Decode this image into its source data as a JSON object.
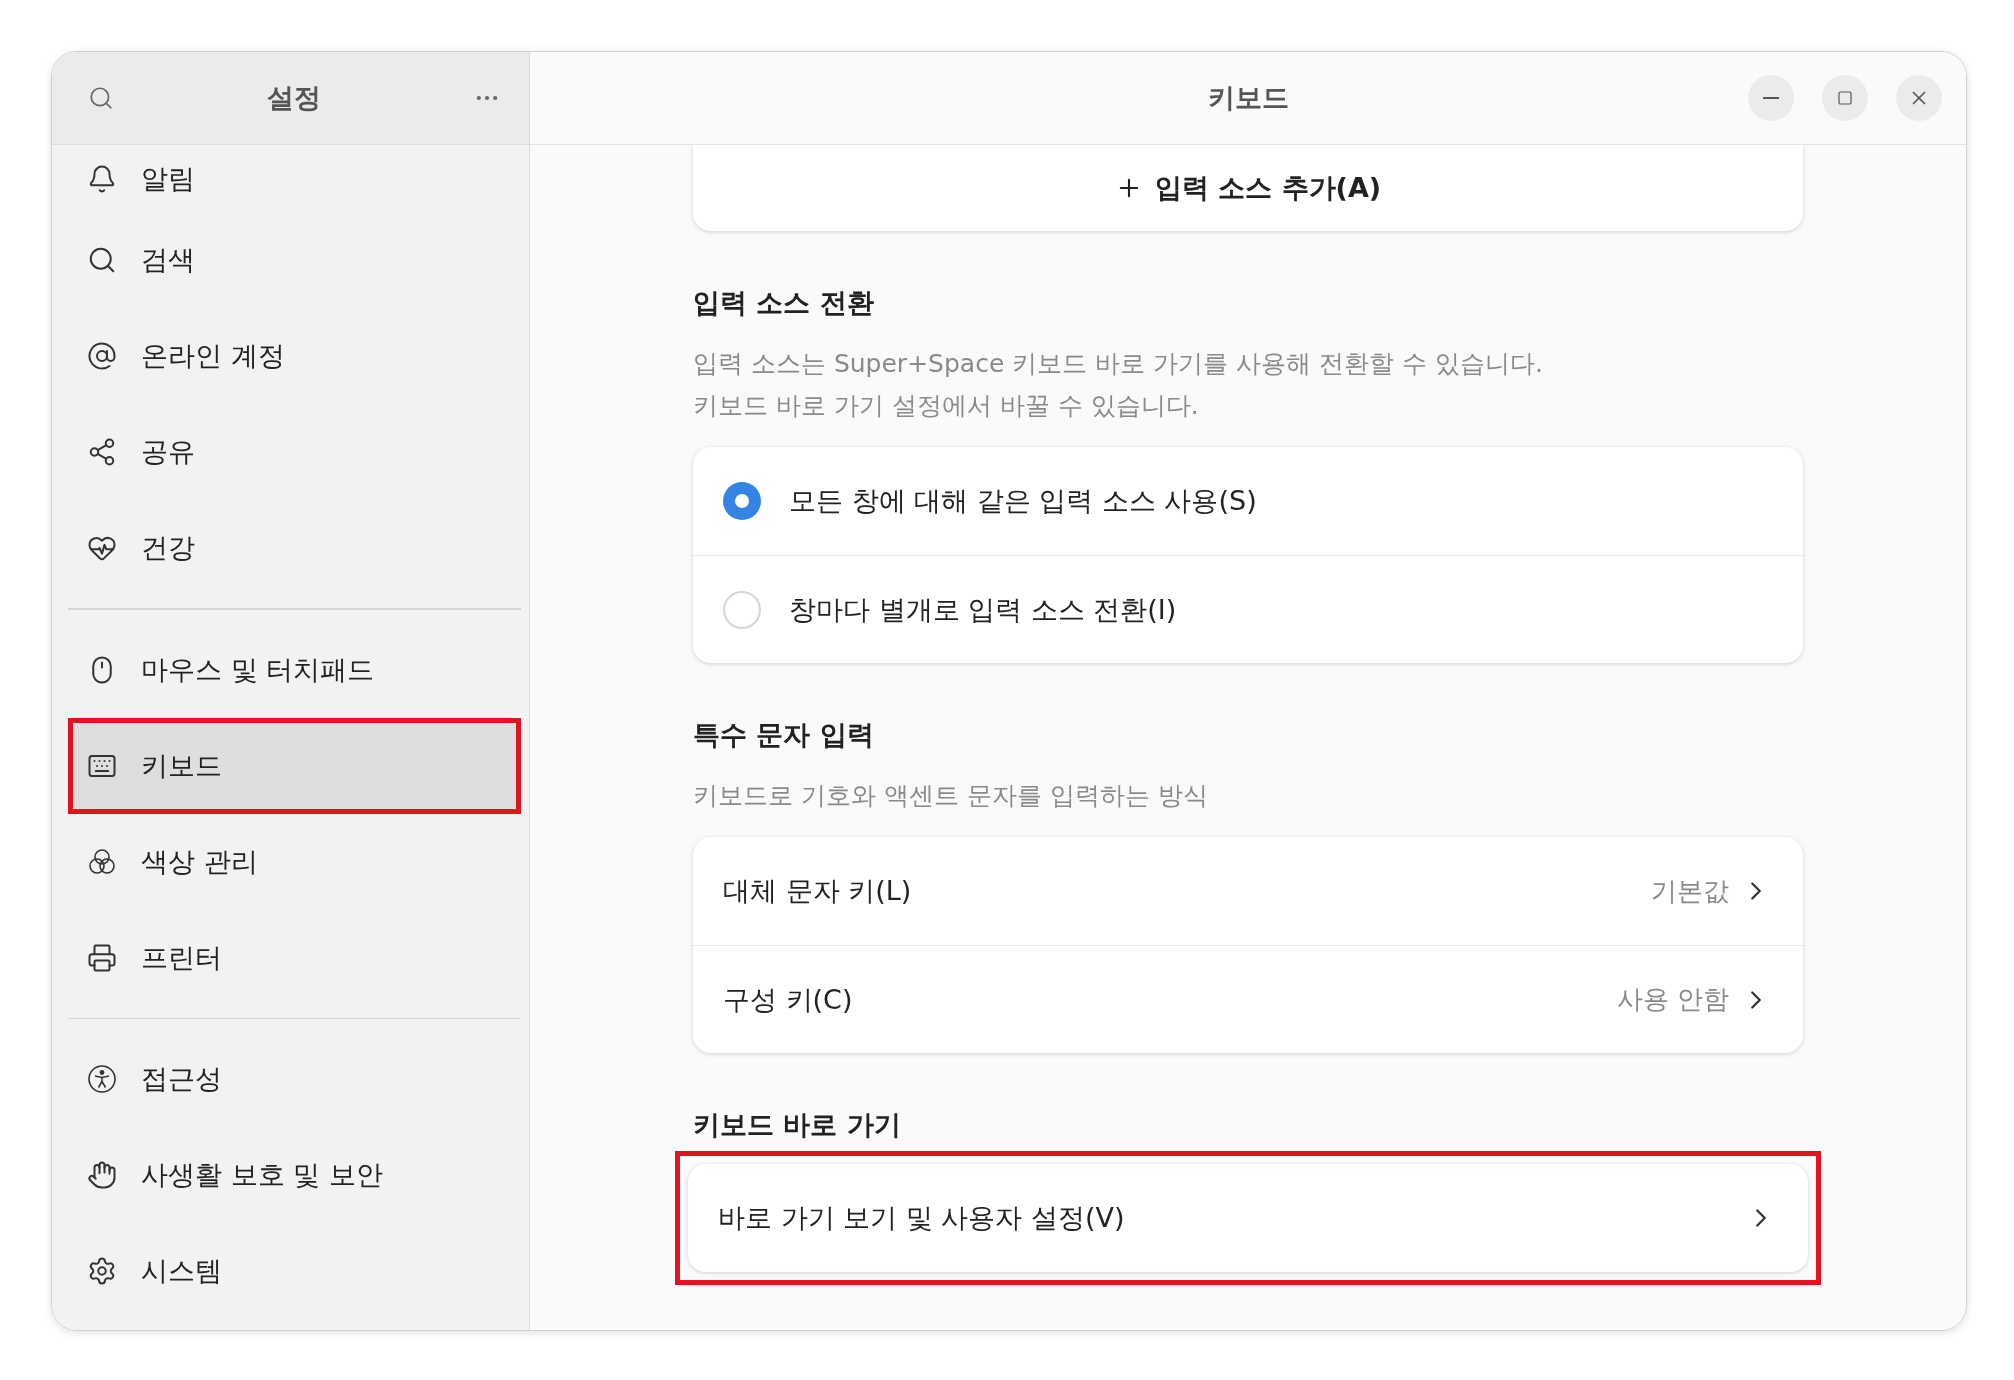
{
  "sidebar": {
    "title": "설정",
    "groups": [
      {
        "items": [
          {
            "label": "알림",
            "selected": false,
            "highlighted": false
          },
          {
            "label": "검색",
            "selected": false,
            "highlighted": false
          },
          {
            "label": "온라인 계정",
            "selected": false,
            "highlighted": false
          },
          {
            "label": "공유",
            "selected": false,
            "highlighted": false
          },
          {
            "label": "건강",
            "selected": false,
            "highlighted": false
          }
        ]
      },
      {
        "items": [
          {
            "label": "마우스 및 터치패드",
            "selected": false,
            "highlighted": false
          },
          {
            "label": "키보드",
            "selected": true,
            "highlighted": true
          },
          {
            "label": "색상 관리",
            "selected": false,
            "highlighted": false
          },
          {
            "label": "프린터",
            "selected": false,
            "highlighted": false
          }
        ]
      },
      {
        "items": [
          {
            "label": "접근성",
            "selected": false,
            "highlighted": false
          },
          {
            "label": "사생활 보호 및 보안",
            "selected": false,
            "highlighted": false
          },
          {
            "label": "시스템",
            "selected": false,
            "highlighted": false
          }
        ]
      }
    ]
  },
  "window": {
    "title": "키보드"
  },
  "add_source": {
    "label": "입력 소스 추가(A)"
  },
  "sections": [
    {
      "kind": "radio",
      "heading": "입력 소스 전환",
      "description": [
        "입력 소스는 Super+Space 키보드 바로 가기를 사용해 전환할 수 있습니다.",
        "키보드 바로 가기 설정에서 바꿀 수 있습니다."
      ],
      "highlighted": false,
      "options": [
        {
          "label": "모든 창에 대해 같은 입력 소스 사용(S)",
          "selected": true
        },
        {
          "label": "창마다 별개로 입력 소스 전환(I)",
          "selected": false
        }
      ]
    },
    {
      "kind": "rows",
      "heading": "특수 문자 입력",
      "description": [
        "키보드로 기호와 액센트 문자를 입력하는 방식"
      ],
      "highlighted": false,
      "rows": [
        {
          "label": "대체 문자 키(L)",
          "value": "기본값"
        },
        {
          "label": "구성 키(C)",
          "value": "사용 안함"
        }
      ]
    },
    {
      "kind": "rows",
      "heading": "키보드 바로 가기",
      "highlighted": true,
      "rows": [
        {
          "label": "바로 가기 보기 및 사용자 설정(V)"
        }
      ]
    }
  ]
}
